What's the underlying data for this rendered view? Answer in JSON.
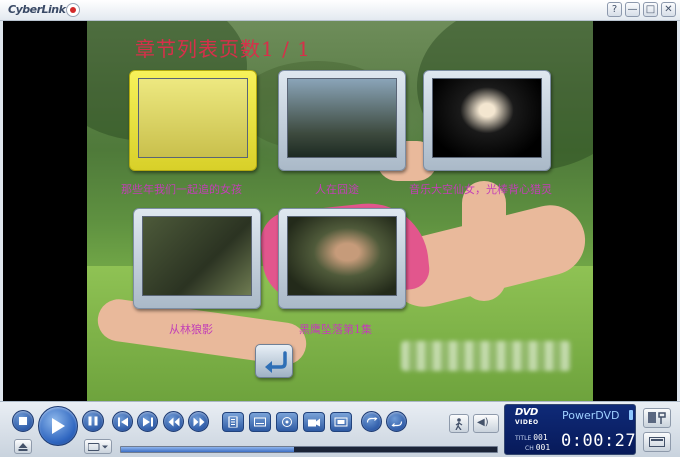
{
  "app": {
    "brand": "CyberLink",
    "window_buttons": [
      "?",
      "—",
      "□",
      "✕"
    ]
  },
  "disc_menu": {
    "title": "章节列表页数1 / 1",
    "chapters": [
      {
        "caption": "那些年我们一起追的女孩",
        "selected": true
      },
      {
        "caption": "人在囧途",
        "selected": false
      },
      {
        "caption": "音乐大空仙女，光棒背心猎灵",
        "selected": false
      },
      {
        "caption": "从林狼影",
        "selected": false
      },
      {
        "caption": "黑鹰坠落第1集",
        "selected": false
      }
    ]
  },
  "controls": {
    "seek_progress": 0.46,
    "volume_label": "◀)",
    "icons": [
      "stop-icon",
      "play-icon",
      "pause-icon",
      "prev-chapter-icon",
      "next-chapter-icon",
      "rewind-icon",
      "fast-forward-icon",
      "menu-icon",
      "subtitles-icon",
      "audio-icon",
      "angle-icon",
      "zoom-icon",
      "repeat-icon",
      "a-b-icon",
      "eject-icon",
      "disc-icon",
      "walk-icon",
      "volume-icon",
      "settings-icon",
      "minimize-player-icon"
    ]
  },
  "status_panel": {
    "disc_type": "DVD",
    "disc_subtype": "VIDEO",
    "product": "PowerDVD",
    "title_label": "TITLE",
    "title_value": "001",
    "chapter_label": "CH",
    "chapter_value": "001",
    "time": "0:00:27"
  },
  "colors": {
    "menu_title": "#d6304a",
    "caption": "#c23fb6",
    "selected_frame": "#f7f25a",
    "lcd_bg": "#0f2a78"
  }
}
